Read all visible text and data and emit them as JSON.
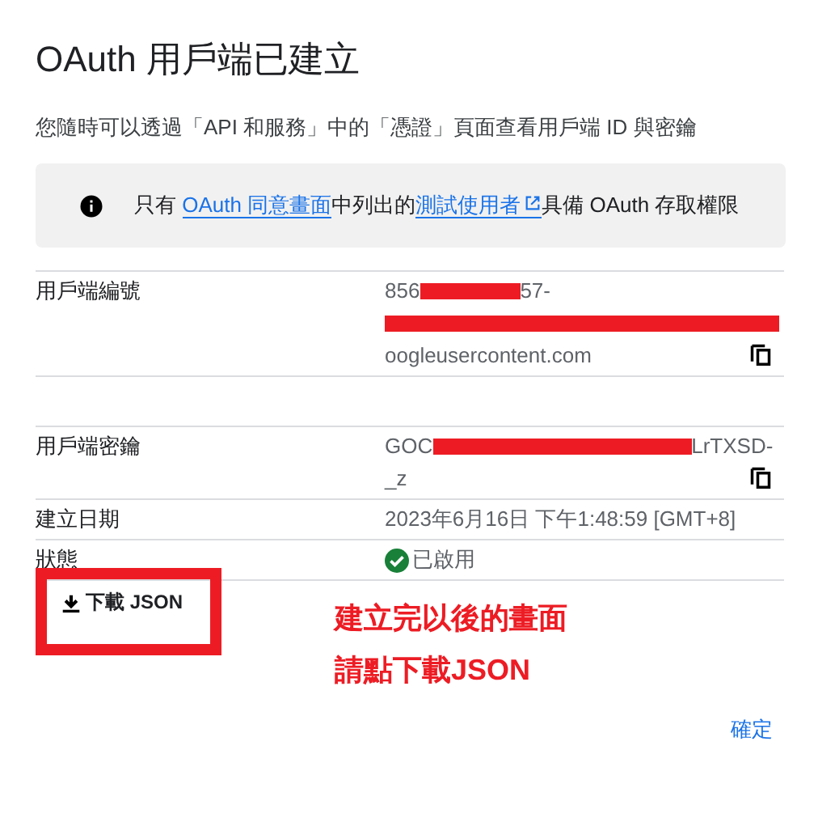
{
  "title": "OAuth 用戶端已建立",
  "description": "您隨時可以透過「API 和服務」中的「憑證」頁面查看用戶端 ID 與密鑰",
  "notice": {
    "before": "只有 ",
    "link1": "OAuth 同意畫面",
    "middle": "中列出的",
    "link2": "測試使用者",
    "after": "具備 OAuth 存取權限"
  },
  "rows": [
    {
      "kind": "value",
      "label": "用戶端編號",
      "copyable": true,
      "lines": [
        [
          {
            "kind": "text",
            "text": "856"
          },
          {
            "kind": "redacted"
          },
          {
            "kind": "text",
            "text": "57-"
          }
        ],
        [
          {
            "kind": "redacted_line"
          }
        ],
        [
          {
            "kind": "text",
            "text": "oogleusercontent.com"
          }
        ]
      ]
    },
    {
      "kind": "spacer"
    },
    {
      "kind": "value",
      "label": "用戶端密鑰",
      "copyable": true,
      "lines": [
        [
          {
            "kind": "text",
            "text": "GOC"
          },
          {
            "kind": "redacted_wide"
          },
          {
            "kind": "text",
            "text": "LrTXSD-"
          }
        ],
        [
          {
            "kind": "text",
            "text": "_z"
          }
        ]
      ]
    },
    {
      "kind": "value",
      "label": "建立日期",
      "copyable": false,
      "lines": [
        [
          {
            "kind": "text",
            "text": "2023年6月16日 下午1:48:59 [GMT+8]"
          }
        ]
      ]
    },
    {
      "kind": "status",
      "label": "狀態",
      "enabled": true,
      "text": "已啟用"
    }
  ],
  "download_button": {
    "label": "下載 JSON",
    "highlighted": true
  },
  "annotation": [
    "建立完以後的畫面",
    "請點下載JSON"
  ],
  "confirm_button": "確定"
}
